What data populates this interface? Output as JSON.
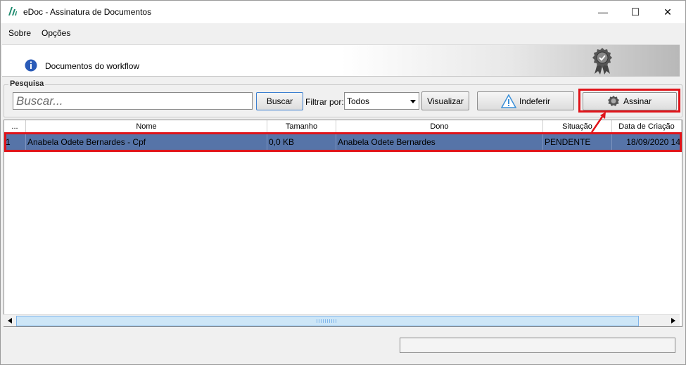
{
  "window": {
    "title": "eDoc - Assinatura de Documentos",
    "minimize": "—",
    "maximize": "☐",
    "close": "✕"
  },
  "menu": {
    "items": [
      "Sobre",
      "Opções"
    ]
  },
  "banner": {
    "text": "Documentos do workflow"
  },
  "search": {
    "group_label": "Pesquisa",
    "placeholder": "Buscar...",
    "search_button": "Buscar",
    "filter_label": "Filtrar por:",
    "filter_value": "Todos",
    "view_button": "Visualizar",
    "reject_button": "Indeferir",
    "sign_button": "Assinar"
  },
  "table": {
    "columns": [
      "...",
      "Nome",
      "Tamanho",
      "Dono",
      "Situação",
      "Data de Criação"
    ],
    "rows": [
      {
        "index": "1",
        "name": "Anabela Odete Bernardes - Cpf",
        "size": "0,0 KB",
        "owner": "Anabela Odete Bernardes",
        "status": "PENDENTE",
        "created": "18/09/2020 14"
      }
    ]
  },
  "colors": {
    "highlight": "#e0141a",
    "selected_row": "#5674a8",
    "info_icon": "#2a5bb8"
  },
  "icons": [
    "app-logo-icon",
    "info-icon",
    "certificate-badge-icon",
    "warning-icon",
    "seal-icon"
  ]
}
